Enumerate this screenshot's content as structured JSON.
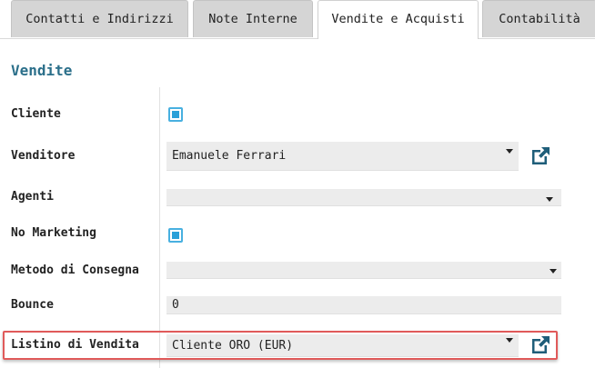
{
  "tabs": [
    {
      "label": "Contatti e Indirizzi",
      "active": false
    },
    {
      "label": "Note Interne",
      "active": false
    },
    {
      "label": "Vendite e Acquisti",
      "active": true
    },
    {
      "label": "Contabilità",
      "active": false
    }
  ],
  "section": {
    "title": "Vendite"
  },
  "fields": {
    "cliente": {
      "label": "Cliente",
      "checked": true
    },
    "venditore": {
      "label": "Venditore",
      "value": "Emanuele Ferrari"
    },
    "agenti": {
      "label": "Agenti",
      "value": ""
    },
    "no_marketing": {
      "label": "No Marketing",
      "checked": true
    },
    "metodo_consegna": {
      "label": "Metodo di Consegna",
      "value": ""
    },
    "bounce": {
      "label": "Bounce",
      "value": "0"
    },
    "listino": {
      "label": "Listino di Vendita",
      "value": "Cliente ORO (EUR)"
    }
  },
  "colors": {
    "accent": "#2b6f8a",
    "checkbox": "#2aa0d8",
    "highlight": "#e05a5a"
  }
}
